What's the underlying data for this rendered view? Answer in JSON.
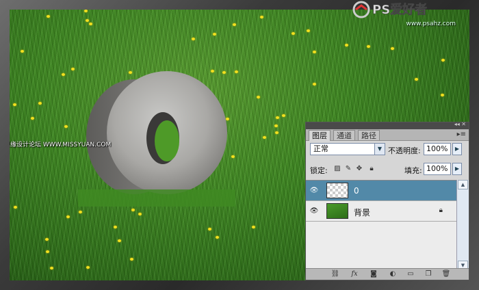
{
  "watermark": {
    "logo_text": "PS爱好者",
    "url": "www.psahz.com",
    "site_left": "思缘设计论坛",
    "site_left_url": "WWW.MISSYUAN.COM"
  },
  "layers_panel": {
    "tabs": [
      {
        "label": "图层",
        "active": true
      },
      {
        "label": "通道",
        "active": false
      },
      {
        "label": "路径",
        "active": false
      }
    ],
    "blend_mode": "正常",
    "opacity_label": "不透明度:",
    "opacity_value": "100%",
    "lock_label": "锁定:",
    "fill_label": "填充:",
    "fill_value": "100%",
    "layers": [
      {
        "name": "0",
        "visible": true,
        "selected": true,
        "thumb": "transparent-checker"
      },
      {
        "name": "背景",
        "visible": true,
        "selected": false,
        "thumb": "grass",
        "locked": true
      }
    ],
    "footer_icons": [
      "link-icon",
      "fx-icon",
      "mask-icon",
      "adjustment-icon",
      "group-icon",
      "new-layer-icon",
      "trash-icon"
    ]
  },
  "colors": {
    "selected_layer": "#5289a8",
    "grass": "#3f8a22",
    "dandelion": "#f2e020"
  }
}
